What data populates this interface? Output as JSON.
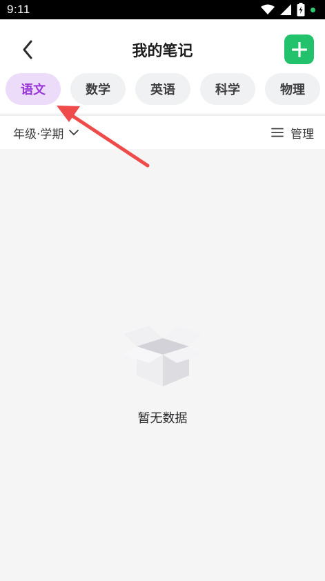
{
  "status_bar": {
    "time": "9:11"
  },
  "header": {
    "title": "我的笔记"
  },
  "tabs": [
    {
      "label": "语文",
      "active": true
    },
    {
      "label": "数学",
      "active": false
    },
    {
      "label": "英语",
      "active": false
    },
    {
      "label": "科学",
      "active": false
    },
    {
      "label": "物理",
      "active": false
    }
  ],
  "filter": {
    "grade_label": "年级·学期",
    "manage_label": "管理"
  },
  "empty_state": {
    "message": "暂无数据"
  },
  "colors": {
    "accent_green": "#21c26b",
    "active_tab_bg": "#ecdcfa",
    "active_tab_text": "#9a37d8",
    "annotation_red": "#ef4b4b"
  },
  "icons": [
    "wifi-icon",
    "signal-icon",
    "battery-icon",
    "back-arrow-icon",
    "plus-icon",
    "chevron-down-icon",
    "menu-icon",
    "empty-box-icon"
  ]
}
